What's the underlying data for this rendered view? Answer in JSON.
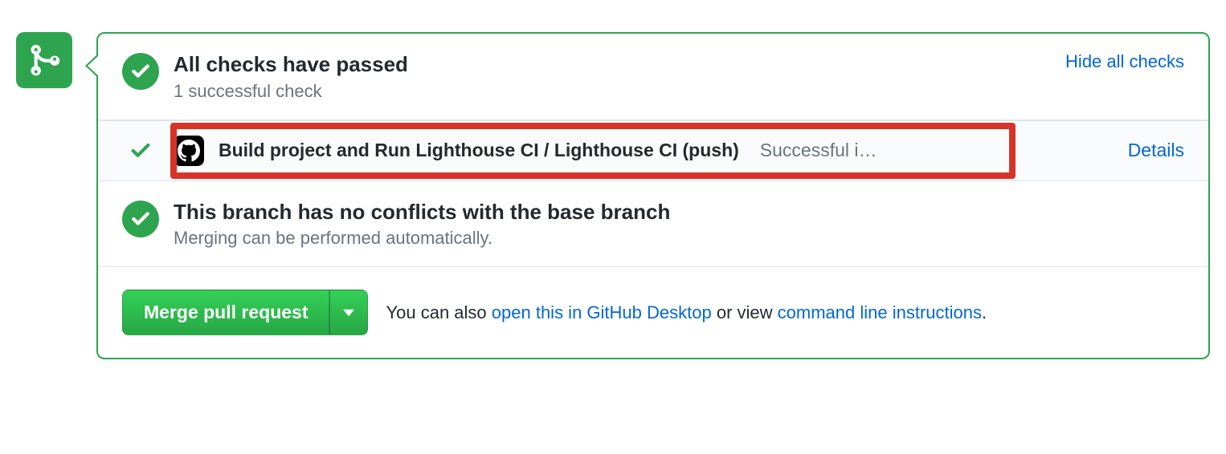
{
  "checks": {
    "title": "All checks have passed",
    "subtitle": "1 successful check",
    "toggle_label": "Hide all checks",
    "items": [
      {
        "name": "Build project and Run Lighthouse CI / Lighthouse CI (push)",
        "status": "Successful i…",
        "details_label": "Details"
      }
    ]
  },
  "conflicts": {
    "title": "This branch has no conflicts with the base branch",
    "subtitle": "Merging can be performed automatically."
  },
  "merge": {
    "button_label": "Merge pull request",
    "text_prefix": "You can also ",
    "desktop_link": "open this in GitHub Desktop",
    "text_mid": " or view ",
    "cli_link": "command line instructions",
    "text_suffix": "."
  }
}
